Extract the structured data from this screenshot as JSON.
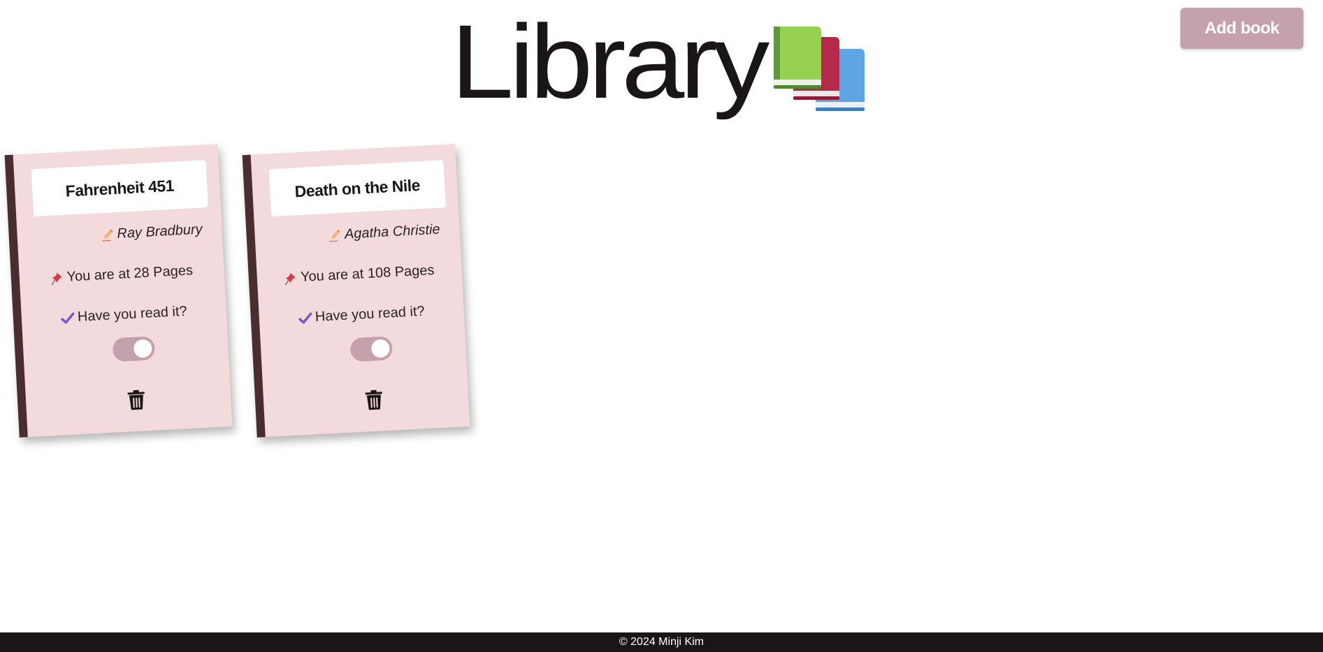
{
  "header": {
    "title": "Library",
    "logo_icon": "books-icon",
    "add_button_label": "Add book"
  },
  "books": [
    {
      "title": "Fahrenheit 451",
      "author": "Ray Bradbury",
      "pages_text": "You are at 28 Pages",
      "read_question": "Have you read it?",
      "read": true
    },
    {
      "title": "Death on the Nile",
      "author": "Agatha Christie",
      "pages_text": "You are at 108 Pages",
      "read_question": "Have you read it?",
      "read": true
    }
  ],
  "icons": {
    "author": "pencil-icon",
    "pages": "pushpin-icon",
    "read": "checkmark-icon",
    "delete": "trash-icon"
  },
  "colors": {
    "card_bg": "#f3dadc",
    "card_spine": "#4a2e2f",
    "accent": "#c4a1ab",
    "text": "#1b1616",
    "footer_bg": "#1b1616"
  },
  "footer": {
    "text": "© 2024 Minji Kim"
  }
}
